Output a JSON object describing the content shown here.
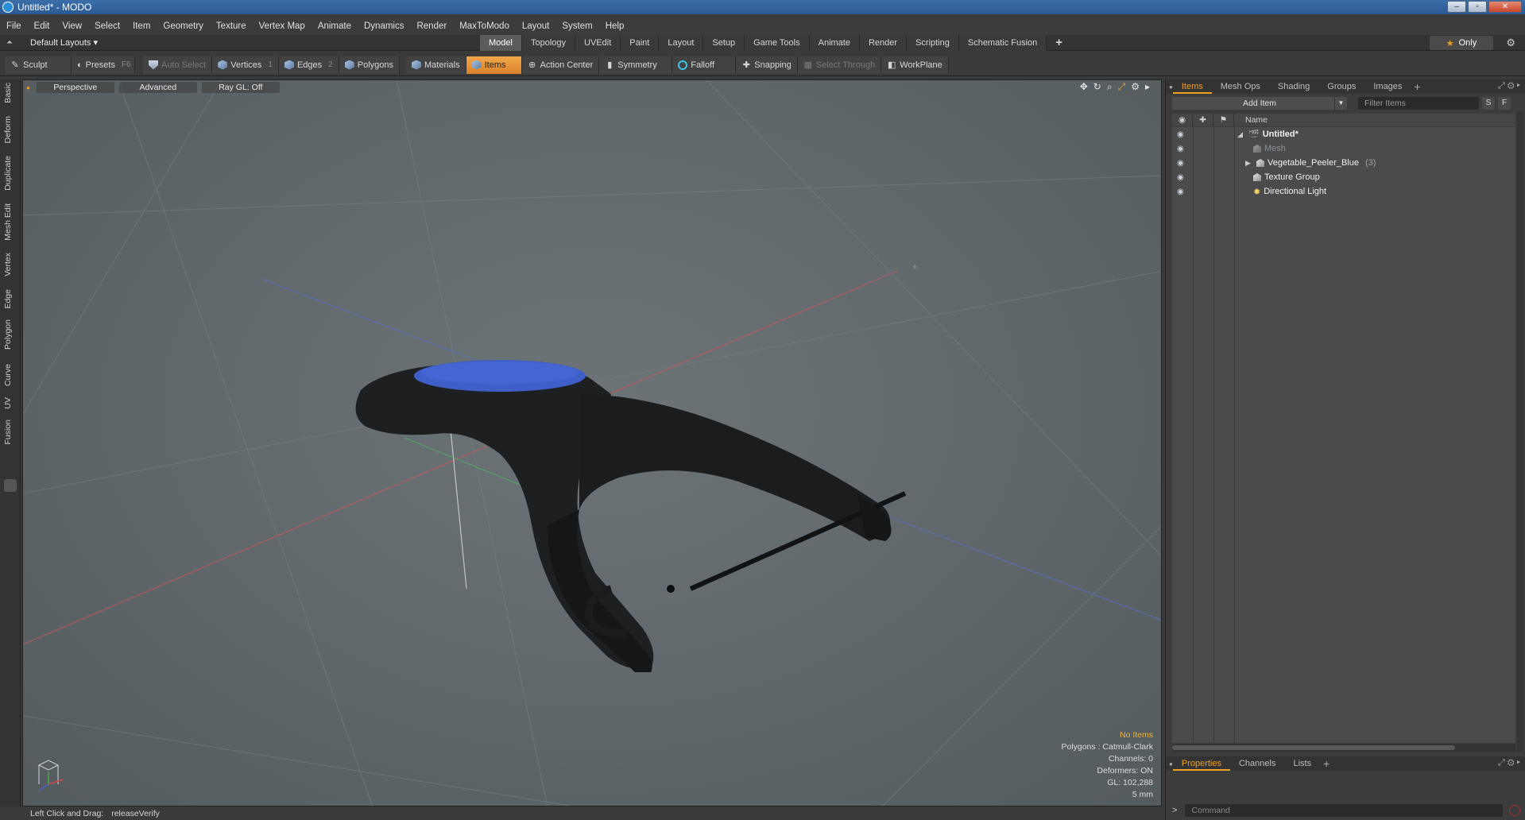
{
  "window": {
    "title": "Untitled* - MODO"
  },
  "menu": [
    "File",
    "Edit",
    "View",
    "Select",
    "Item",
    "Geometry",
    "Texture",
    "Vertex Map",
    "Animate",
    "Dynamics",
    "Render",
    "MaxToModo",
    "Layout",
    "System",
    "Help"
  ],
  "layout_bar": {
    "layouts_label": "Default Layouts ▾",
    "tabs": [
      "Model",
      "Topology",
      "UVEdit",
      "Paint",
      "Layout",
      "Setup",
      "Game Tools",
      "Animate",
      "Render",
      "Scripting",
      "Schematic Fusion"
    ],
    "active_tab": "Model",
    "plus": "+",
    "only_label": "Only"
  },
  "toolbar": {
    "sculpt": "Sculpt",
    "presets": "Presets",
    "presets_key": "F6",
    "auto_select": "Auto Select",
    "vertices": "Vertices",
    "vertices_key": "1",
    "edges": "Edges",
    "edges_key": "2",
    "polygons": "Polygons",
    "materials": "Materials",
    "items": "Items",
    "action_center": "Action Center",
    "symmetry": "Symmetry",
    "falloff": "Falloff",
    "snapping": "Snapping",
    "select_through": "Select Through",
    "workplane": "WorkPlane"
  },
  "left_tabs": [
    "Basic",
    "Deform",
    "Duplicate",
    "Mesh Edit",
    "Vertex",
    "Edge",
    "Polygon",
    "Curve",
    "UV",
    "Fusion"
  ],
  "viewport": {
    "perspective": "Perspective",
    "advanced": "Advanced",
    "raygl": "Ray GL: Off",
    "hud": {
      "no_items": "No Items",
      "polygons": "Polygons : Catmull-Clark",
      "channels": "Channels: 0",
      "deformers": "Deformers: ON",
      "gl": "GL: 102,288",
      "scale": "5 mm"
    }
  },
  "status": {
    "hint": "Left Click and Drag:",
    "action": "releaseVerify"
  },
  "items_panel": {
    "tabs": [
      "Items",
      "Mesh Ops",
      "Shading",
      "Groups",
      "Images"
    ],
    "active_tab": "Items",
    "plus": "+",
    "add_item": "Add Item",
    "filter_placeholder": "Filter Items",
    "s_btn": "S",
    "f_btn": "F",
    "name_header": "Name",
    "rows": [
      {
        "name": "Untitled*"
      },
      {
        "name": "Mesh"
      },
      {
        "name": "Vegetable_Peeler_Blue",
        "count": "(3)"
      },
      {
        "name": "Texture Group"
      },
      {
        "name": "Directional Light"
      }
    ]
  },
  "properties_panel": {
    "tabs": [
      "Properties",
      "Channels",
      "Lists"
    ],
    "active_tab": "Properties",
    "plus": "+"
  },
  "command": {
    "prompt": ">",
    "placeholder": "Command"
  },
  "colors": {
    "accent": "#f0a020",
    "viewport_bg": "#5f676b",
    "peeler_blue": "#3f5fc8"
  }
}
